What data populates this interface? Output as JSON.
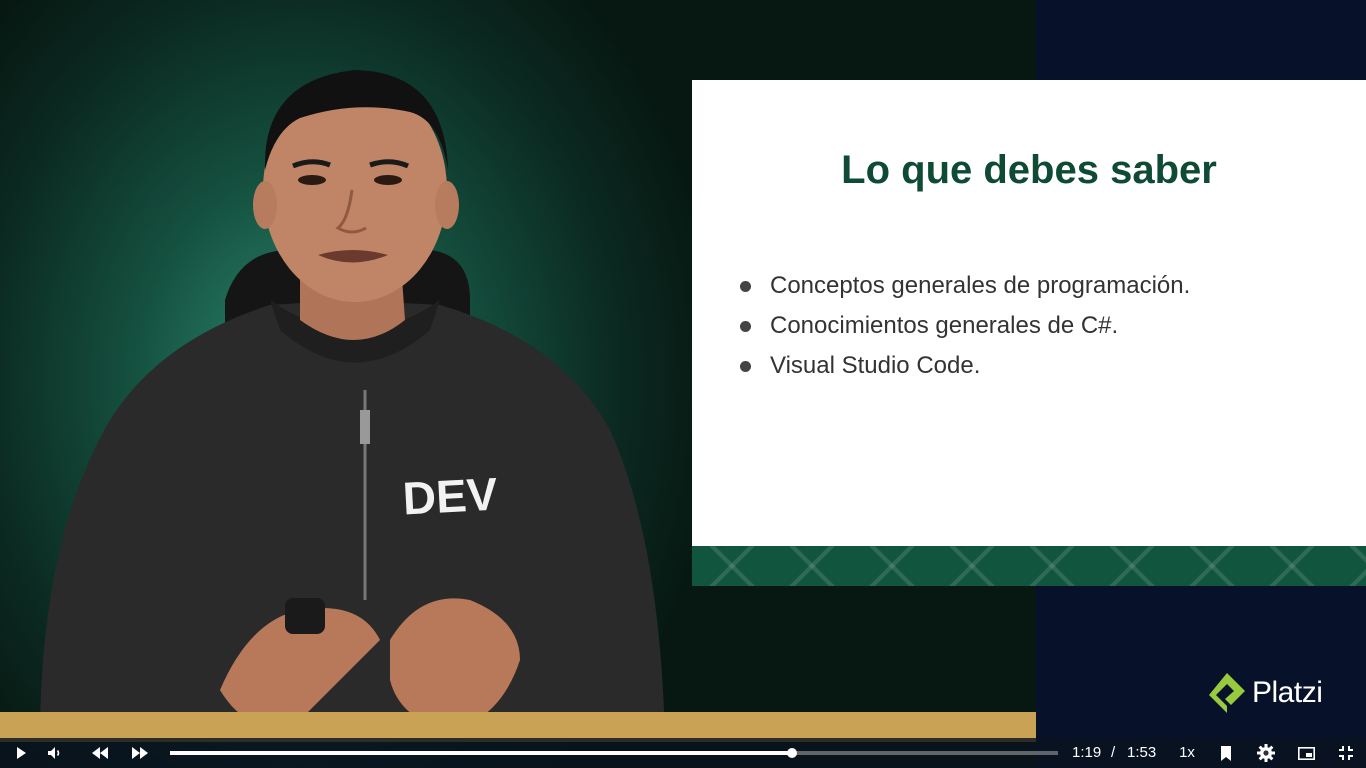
{
  "slide": {
    "title": "Lo que debes saber",
    "bullets": [
      "Conceptos generales de programación.",
      "Conocimientos generales de C#.",
      "Visual Studio Code."
    ]
  },
  "presenter": {
    "shirt_text": "DEV"
  },
  "brand": {
    "logo_text": "Platzi",
    "accent_color": "#98ca3f"
  },
  "player": {
    "current_time": "1:19",
    "separator": "/",
    "duration": "1:53",
    "progress_fraction": 0.7,
    "speed": "1x",
    "icons": [
      "play-icon",
      "volume-icon",
      "rewind-icon",
      "fast-forward-icon",
      "bookmark-icon",
      "gear-icon",
      "picture-in-picture-icon",
      "exit-fullscreen-icon"
    ]
  }
}
